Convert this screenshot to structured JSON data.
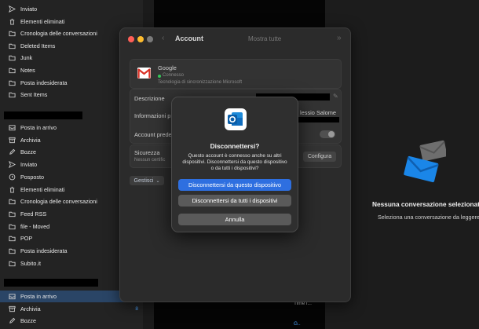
{
  "sidebar": {
    "group1": [
      {
        "label": "Inviato",
        "icon": "send-icon"
      },
      {
        "label": "Elementi eliminati",
        "icon": "trash-icon"
      },
      {
        "label": "Cronologia delle conversazioni",
        "icon": "folder-icon"
      },
      {
        "label": "Deleted Items",
        "icon": "folder-icon"
      },
      {
        "label": "Junk",
        "icon": "folder-icon"
      },
      {
        "label": "Notes",
        "icon": "folder-icon"
      },
      {
        "label": "Posta indesiderata",
        "icon": "folder-icon"
      },
      {
        "label": "Sent Items",
        "icon": "folder-icon"
      }
    ],
    "group2": [
      {
        "label": "Posta in arrivo",
        "icon": "inbox-icon"
      },
      {
        "label": "Archivia",
        "icon": "archive-icon"
      },
      {
        "label": "Bozze",
        "icon": "draft-icon"
      },
      {
        "label": "Inviato",
        "icon": "send-icon"
      },
      {
        "label": "Posposto",
        "icon": "clock-icon"
      },
      {
        "label": "Elementi eliminati",
        "icon": "trash-icon"
      },
      {
        "label": "Cronologia delle conversazioni",
        "icon": "folder-icon"
      },
      {
        "label": "Feed RSS",
        "icon": "folder-icon"
      },
      {
        "label": "file - Moved",
        "icon": "folder-icon"
      },
      {
        "label": "POP",
        "icon": "folder-icon"
      },
      {
        "label": "Posta indesiderata",
        "icon": "folder-icon"
      },
      {
        "label": "Subito.it",
        "icon": "folder-icon"
      }
    ],
    "group3": [
      {
        "label": "Posta in arrivo",
        "icon": "inbox-icon",
        "selected": true
      },
      {
        "label": "Archivia",
        "icon": "archive-icon",
        "count": "8"
      },
      {
        "label": "Bozze",
        "icon": "draft-icon"
      }
    ]
  },
  "settings": {
    "title": "Account",
    "show_all": "Mostra tutte",
    "account_name": "Google",
    "account_status": "Connesso",
    "account_sub": "Tecnologia di sincronizzazione Microsoft",
    "descrizione": "Descrizione",
    "informazioni": "Informazioni p",
    "user_name_partial": "lessio Salome",
    "account_predef": "Account prede",
    "sicurezza": "Sicurezza",
    "sicurezza_sub": "Nessun certific",
    "configura": "Configura",
    "gestisci": "Gestisci"
  },
  "dialog": {
    "title": "Disconnettersi?",
    "message": "Questo account è connesso anche su altri dispositivi. Disconnettersi da questo dispositivo o da tutti i dispositivi?",
    "btn_this": "Disconnettersi da questo dispositivo",
    "btn_all": "Disconnettersi da tutti i dispositivi",
    "btn_cancel": "Annulla"
  },
  "list_peek": {
    "time": "Time i..."
  },
  "reading": {
    "empty_title": "Nessuna conversazione selezionata",
    "empty_sub": "Seleziona una conversazione da leggere."
  },
  "colors": {
    "accent": "#2e6fe0",
    "selected_row": "#2a4566"
  }
}
